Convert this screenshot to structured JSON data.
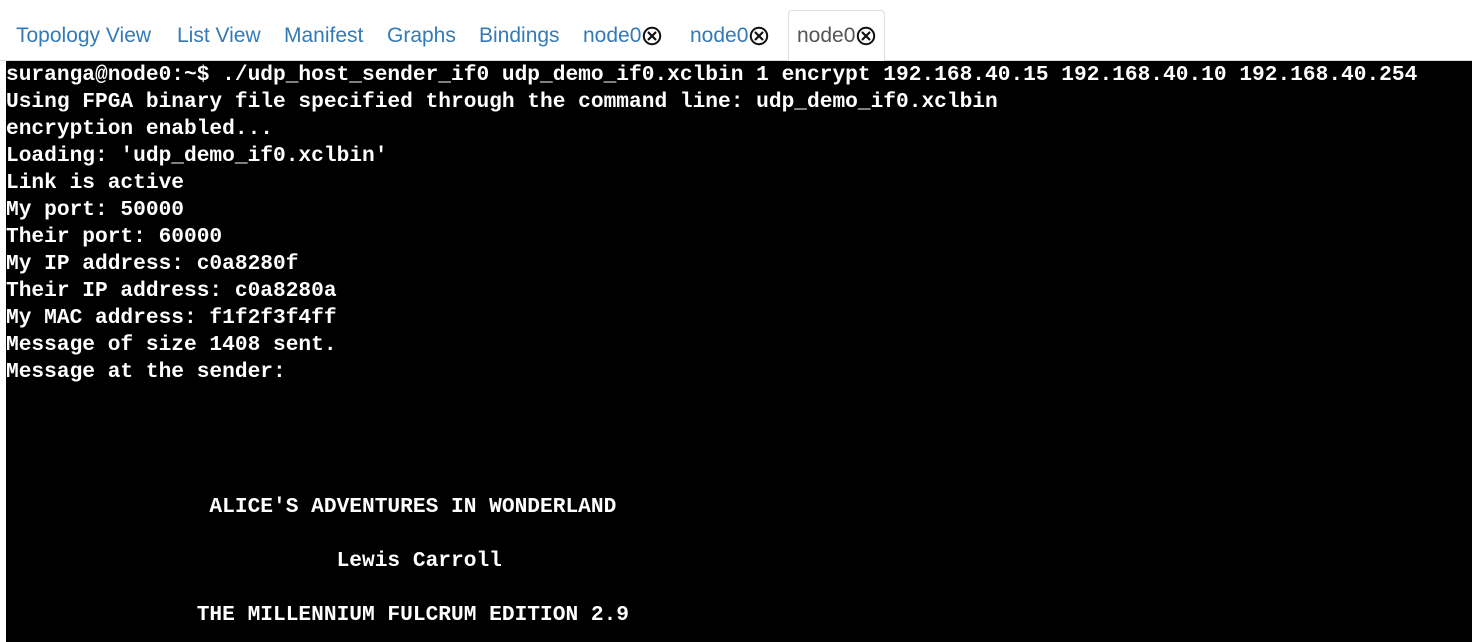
{
  "tabs": [
    {
      "label": "Topology View",
      "closable": false,
      "active": false
    },
    {
      "label": "List View",
      "closable": false,
      "active": false
    },
    {
      "label": "Manifest",
      "closable": false,
      "active": false
    },
    {
      "label": "Graphs",
      "closable": false,
      "active": false
    },
    {
      "label": "Bindings",
      "closable": false,
      "active": false
    },
    {
      "label": "node0",
      "closable": true,
      "active": false
    },
    {
      "label": "node0",
      "closable": true,
      "active": false
    },
    {
      "label": "node0",
      "closable": true,
      "active": true
    }
  ],
  "icons": {
    "tab_close": "close-circle-icon"
  },
  "colors": {
    "link": "#337ab7",
    "active_tab_text": "#555555",
    "terminal_bg": "#000000",
    "terminal_fg": "#ffffff"
  },
  "terminal": {
    "lines": [
      "suranga@node0:~$ ./udp_host_sender_if0 udp_demo_if0.xclbin 1 encrypt 192.168.40.15 192.168.40.10 192.168.40.254",
      "Using FPGA binary file specified through the command line: udp_demo_if0.xclbin",
      "encryption enabled...",
      "Loading: 'udp_demo_if0.xclbin'",
      "Link is active",
      "My port: 50000",
      "Their port: 60000",
      "My IP address: c0a8280f",
      "Their IP address: c0a8280a",
      "My MAC address: f1f2f3f4ff",
      "Message of size 1408 sent.",
      "Message at the sender:",
      "",
      "",
      "",
      "",
      "                ALICE'S ADVENTURES IN WONDERLAND",
      "",
      "                          Lewis Carroll",
      "",
      "               THE MILLENNIUM FULCRUM EDITION 2.9"
    ]
  }
}
